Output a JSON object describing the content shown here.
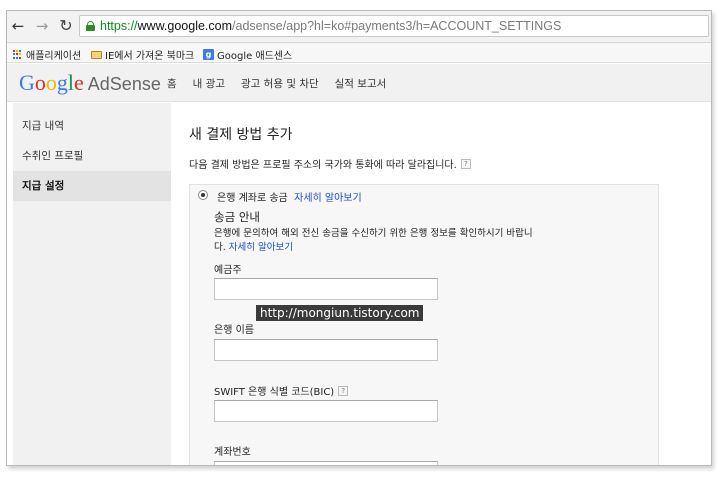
{
  "browser": {
    "url_scheme": "https://",
    "url_host": "www.google.com",
    "url_path": "/adsense/app?hl=ko#payments3/h=ACCOUNT_SETTINGS",
    "bookmarks": [
      {
        "label": "애플리케이션",
        "icon": "apps-icon"
      },
      {
        "label": "IE에서 가져온 북마크",
        "icon": "folder-icon"
      },
      {
        "label": "Google 애드센스",
        "icon": "google-icon"
      }
    ]
  },
  "header": {
    "logo_google": "Google",
    "logo_product": "AdSense",
    "nav": [
      "홈",
      "내 광고",
      "광고 허용 및 차단",
      "실적 보고서"
    ]
  },
  "sidebar": {
    "items": [
      {
        "label": "지급 내역"
      },
      {
        "label": "수취인 프로필"
      },
      {
        "label": "지급 설정"
      }
    ]
  },
  "main": {
    "title": "새 결제 방법 추가",
    "subtitle": "다음 결제 방법은 프로필 주소의 국가와 통화에 따라 달라집니다.",
    "option": {
      "label": "은행 계좌로 송금",
      "link": "자세히 알아보기"
    },
    "guide": {
      "title": "송금 안내",
      "text": "은행에 문의하여 해외 전신 송금을 수신하기 위한 은행 정보를 확인하시기 바랍니다.",
      "link": "자세히 알아보기"
    },
    "fields": [
      {
        "label": "예금주",
        "value": ""
      },
      {
        "label": "은행 이름",
        "value": ""
      },
      {
        "label": "SWIFT 은행 식별 코드(BIC)",
        "value": ""
      },
      {
        "label": "계좌번호",
        "value": ""
      }
    ]
  },
  "watermark": "http://mongiun.tistory.com",
  "colors": {
    "link": "#1a4cc7",
    "secure_scheme": "#0b8c1e",
    "google_blue": "#3b7be3",
    "google_red": "#d93025",
    "google_yellow": "#f4b400",
    "google_green": "#0f9d58"
  }
}
